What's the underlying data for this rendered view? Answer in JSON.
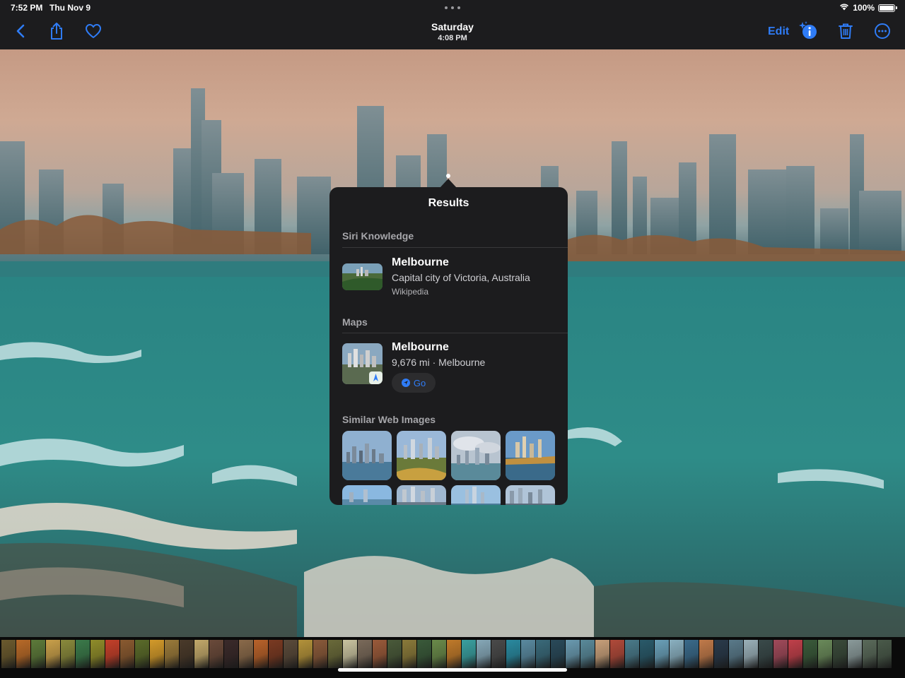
{
  "status_bar": {
    "time": "7:52 PM",
    "date": "Thu Nov 9",
    "battery_text": "100%",
    "battery_level": 1.0
  },
  "nav": {
    "title": "Saturday",
    "subtitle": "4:08 PM",
    "edit_label": "Edit",
    "accent_color": "#2f7cf6"
  },
  "results": {
    "title": "Results",
    "siri_section": "Siri Knowledge",
    "siri_item": {
      "title": "Melbourne",
      "subtitle": "Capital city of Victoria, Australia",
      "source": "Wikipedia"
    },
    "maps_section": "Maps",
    "maps_item": {
      "title": "Melbourne",
      "subtitle": "9,676 mi · Melbourne",
      "go_label": "Go"
    },
    "web_section": "Similar Web Images"
  },
  "filmstrip_colors": [
    "#6b5a2e",
    "#b86a28",
    "#5d7a3a",
    "#c9a04a",
    "#8a8a3c",
    "#3b7a4a",
    "#8f8c2a",
    "#c4402a",
    "#8a5a30",
    "#5b6b2a",
    "#d39a2a",
    "#9a7a3a",
    "#4a3a2a",
    "#c2a86a",
    "#6a4a3a",
    "#3a2a2a",
    "#8a6a4a",
    "#b9622a",
    "#7a3a22",
    "#5a4a3a",
    "#b3923a",
    "#8a5a3a",
    "#6a6a3a",
    "#c9c3a0",
    "#7a6a5a",
    "#9a5a3a",
    "#4a5a3a",
    "#8a7a3a",
    "#3a5a3a",
    "#6a8a4a",
    "#c07a2a",
    "#3aa0a0",
    "#86a8b8",
    "#4a4a4a",
    "#2a8aa0",
    "#5a8aa0",
    "#3a6a7a",
    "#2a4a5a",
    "#6a9ab0",
    "#5a8a9a",
    "#c8a07a",
    "#b04a3a",
    "#4a7a8a",
    "#2a5a6a",
    "#6aa0b8",
    "#8ab0c0",
    "#3a6a8a",
    "#c07a4a",
    "#2a3a4a",
    "#5a7a8a",
    "#9ab0b8",
    "#3a4a4a",
    "#a04a5a",
    "#c0404a",
    "#3a5a3a",
    "#6a8a5a",
    "#3a4a3a",
    "#8a9a9a",
    "#5a6a5a",
    "#4a5a4a",
    "#7aa0c0",
    "#8a6a3a",
    "#5a8a6a",
    "#3a6a5a",
    "#2a3a3a",
    "#6a9aaa",
    "#4a8ab0",
    "#9ab0c0",
    "#b07a8a",
    "#7a9a6a",
    "#c0a080",
    "#9a8a7a",
    "#6a5a4a"
  ]
}
